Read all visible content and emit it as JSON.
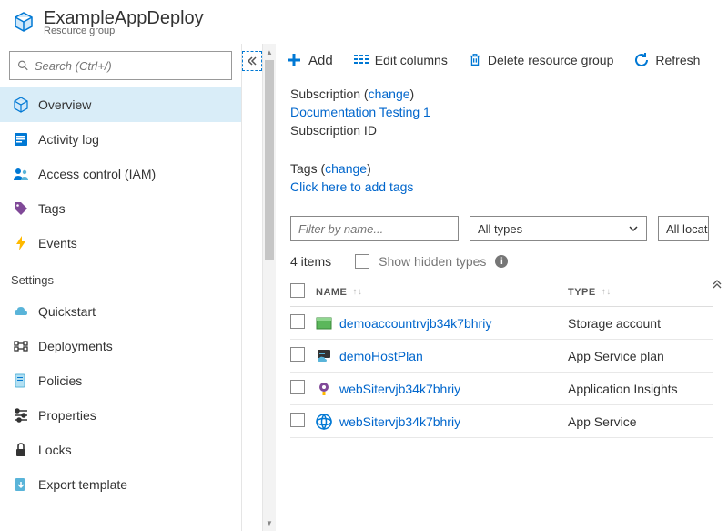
{
  "header": {
    "title": "ExampleAppDeploy",
    "subtitle": "Resource group"
  },
  "search": {
    "placeholder": "Search (Ctrl+/)"
  },
  "nav": {
    "items": [
      {
        "label": "Overview",
        "icon": "cube",
        "selected": true
      },
      {
        "label": "Activity log",
        "icon": "log",
        "selected": false
      },
      {
        "label": "Access control (IAM)",
        "icon": "iam",
        "selected": false
      },
      {
        "label": "Tags",
        "icon": "tag",
        "selected": false
      },
      {
        "label": "Events",
        "icon": "bolt",
        "selected": false
      }
    ],
    "section": "Settings",
    "settings": [
      {
        "label": "Quickstart",
        "icon": "cloud"
      },
      {
        "label": "Deployments",
        "icon": "deploy"
      },
      {
        "label": "Policies",
        "icon": "policy"
      },
      {
        "label": "Properties",
        "icon": "props"
      },
      {
        "label": "Locks",
        "icon": "lock"
      },
      {
        "label": "Export template",
        "icon": "export"
      }
    ]
  },
  "toolbar": {
    "add": "Add",
    "edit_columns": "Edit columns",
    "delete": "Delete resource group",
    "refresh": "Refresh"
  },
  "info": {
    "subscription_label": "Subscription",
    "change": "change",
    "subscription_name": "Documentation Testing 1",
    "subscription_id_label": "Subscription ID",
    "tags_label": "Tags",
    "tags_link": "Click here to add tags"
  },
  "filters": {
    "placeholder": "Filter by name...",
    "types": "All types",
    "locations": "All locations"
  },
  "list": {
    "count": "4 items",
    "hidden_label": "Show hidden types",
    "col_name": "NAME",
    "col_type": "TYPE",
    "rows": [
      {
        "name": "demoaccountrvjb34k7bhriy",
        "type": "Storage account",
        "icon": "storage"
      },
      {
        "name": "demoHostPlan",
        "type": "App Service plan",
        "icon": "plan"
      },
      {
        "name": "webSitervjb34k7bhriy",
        "type": "Application Insights",
        "icon": "insights"
      },
      {
        "name": "webSitervjb34k7bhriy",
        "type": "App Service",
        "icon": "appservice"
      }
    ]
  }
}
